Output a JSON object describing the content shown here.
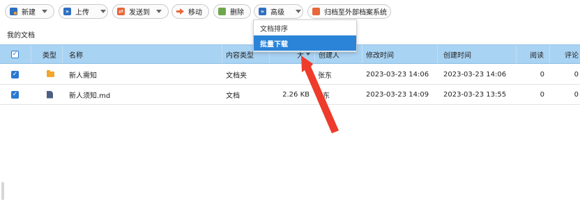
{
  "toolbar": {
    "new": "新建",
    "upload": "上传",
    "send_to": "发送到",
    "move": "移动",
    "delete": "删除",
    "advanced": "高级",
    "archive": "归档至外部档案系统"
  },
  "breadcrumb": "我的文档",
  "columns": {
    "type": "类型",
    "name": "名称",
    "content_type": "内容类型",
    "size": "大",
    "creator": "创建人",
    "modified": "修改时间",
    "created": "创建时间",
    "reads": "阅读",
    "comments": "评论"
  },
  "rows": [
    {
      "icon": "folder-icon",
      "name": "新人需知",
      "content_type": "文档夹",
      "size": "",
      "creator": "张东",
      "modified": "2023-03-23 14:06",
      "created": "2023-03-23 14:06",
      "reads": "0",
      "comments": "0",
      "checked": true
    },
    {
      "icon": "document-icon",
      "name": "新人须知.md",
      "content_type": "文档",
      "size": "2.26 KB",
      "creator": "东",
      "modified": "2023-03-23 14:09",
      "created": "2023-03-23 13:55",
      "reads": "0",
      "comments": "0",
      "checked": true
    }
  ],
  "advanced_menu": {
    "items": [
      {
        "label": "文档排序",
        "active": false
      },
      {
        "label": "批量下载",
        "active": true
      }
    ]
  },
  "colors": {
    "header_bg": "#a9d3f3",
    "menu_highlight": "#2b84d8",
    "annotation_arrow": "#ee3b2b"
  }
}
